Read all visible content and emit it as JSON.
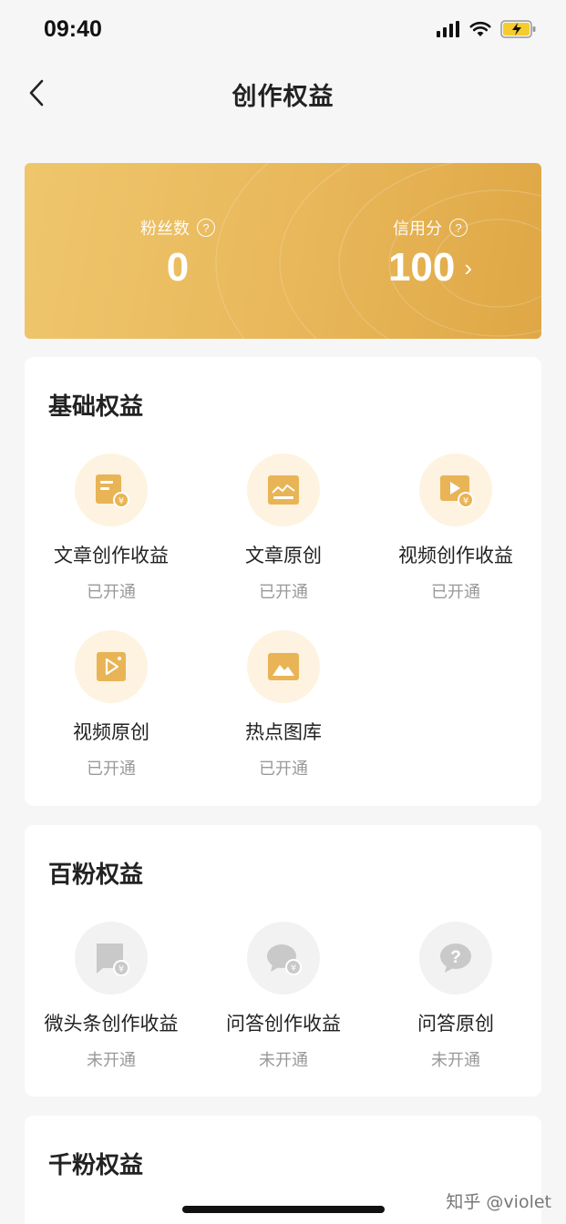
{
  "status_bar": {
    "time": "09:40"
  },
  "nav": {
    "title": "创作权益"
  },
  "stats": {
    "fans_label": "粉丝数",
    "fans_value": "0",
    "credit_label": "信用分",
    "credit_value": "100",
    "help_glyph": "?",
    "chevron_glyph": "›"
  },
  "sections": [
    {
      "title": "基础权益",
      "items": [
        {
          "label": "文章创作收益",
          "status": "已开通",
          "icon": "article-income-icon"
        },
        {
          "label": "文章原创",
          "status": "已开通",
          "icon": "article-original-icon"
        },
        {
          "label": "视频创作收益",
          "status": "已开通",
          "icon": "video-income-icon"
        },
        {
          "label": "视频原创",
          "status": "已开通",
          "icon": "video-original-icon"
        },
        {
          "label": "热点图库",
          "status": "已开通",
          "icon": "image-library-icon"
        }
      ]
    },
    {
      "title": "百粉权益",
      "items": [
        {
          "label": "微头条创作收益",
          "status": "未开通",
          "icon": "micro-post-income-icon"
        },
        {
          "label": "问答创作收益",
          "status": "未开通",
          "icon": "qa-income-icon"
        },
        {
          "label": "问答原创",
          "status": "未开通",
          "icon": "qa-original-icon"
        }
      ]
    },
    {
      "title": "千粉权益",
      "items": []
    }
  ],
  "watermark": "知乎 @violet",
  "colors": {
    "gold_start": "#efc66c",
    "gold_end": "#dfa745",
    "icon_gold": "#e8b456",
    "icon_gray": "#c9c9c9"
  }
}
